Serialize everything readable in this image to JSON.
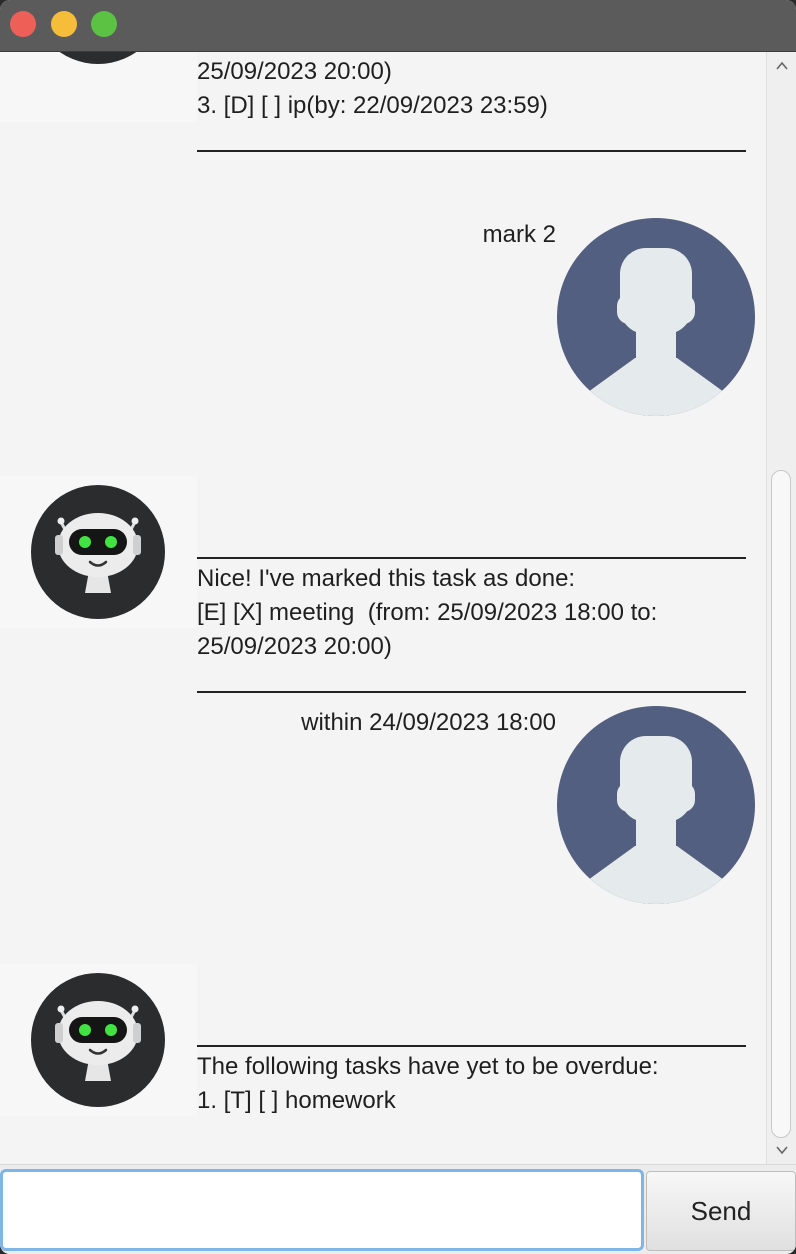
{
  "window": {
    "buttons": [
      "close",
      "minimize",
      "maximize"
    ]
  },
  "conversation": [
    {
      "role": "bot",
      "lines": [
        "25/09/2023 20:00)",
        "3. [D] [ ] ip(by: 22/09/2023 23:59)"
      ],
      "divider": "________________________________________"
    },
    {
      "role": "user",
      "text": "mark 2"
    },
    {
      "role": "bot",
      "divider": "________________________________________",
      "lines": [
        "Nice! I've marked this task as done:",
        "[E] [X] meeting  (from: 25/09/2023 18:00 to:",
        "25/09/2023 20:00)"
      ]
    },
    {
      "role": "user",
      "text": "within 24/09/2023 18:00"
    },
    {
      "role": "bot",
      "divider": "________________________________________",
      "lines": [
        "The following tasks have yet to be overdue:",
        "1. [T] [ ] homework"
      ]
    }
  ],
  "input": {
    "value": "",
    "placeholder": ""
  },
  "send_label": "Send",
  "icons": {
    "bot_avatar": "robot-icon",
    "user_avatar": "user-silhouette-icon",
    "scroll_up": "chevron-up-icon",
    "scroll_down": "chevron-down-icon"
  },
  "colors": {
    "titlebar": "#5b5b5b",
    "user_avatar_bg": "#525f80",
    "user_silhouette": "#e5ebed",
    "bot_avatar_bg": "#2b2c2e",
    "bot_eyes": "#43e243",
    "input_focus": "#7fb6e6"
  }
}
